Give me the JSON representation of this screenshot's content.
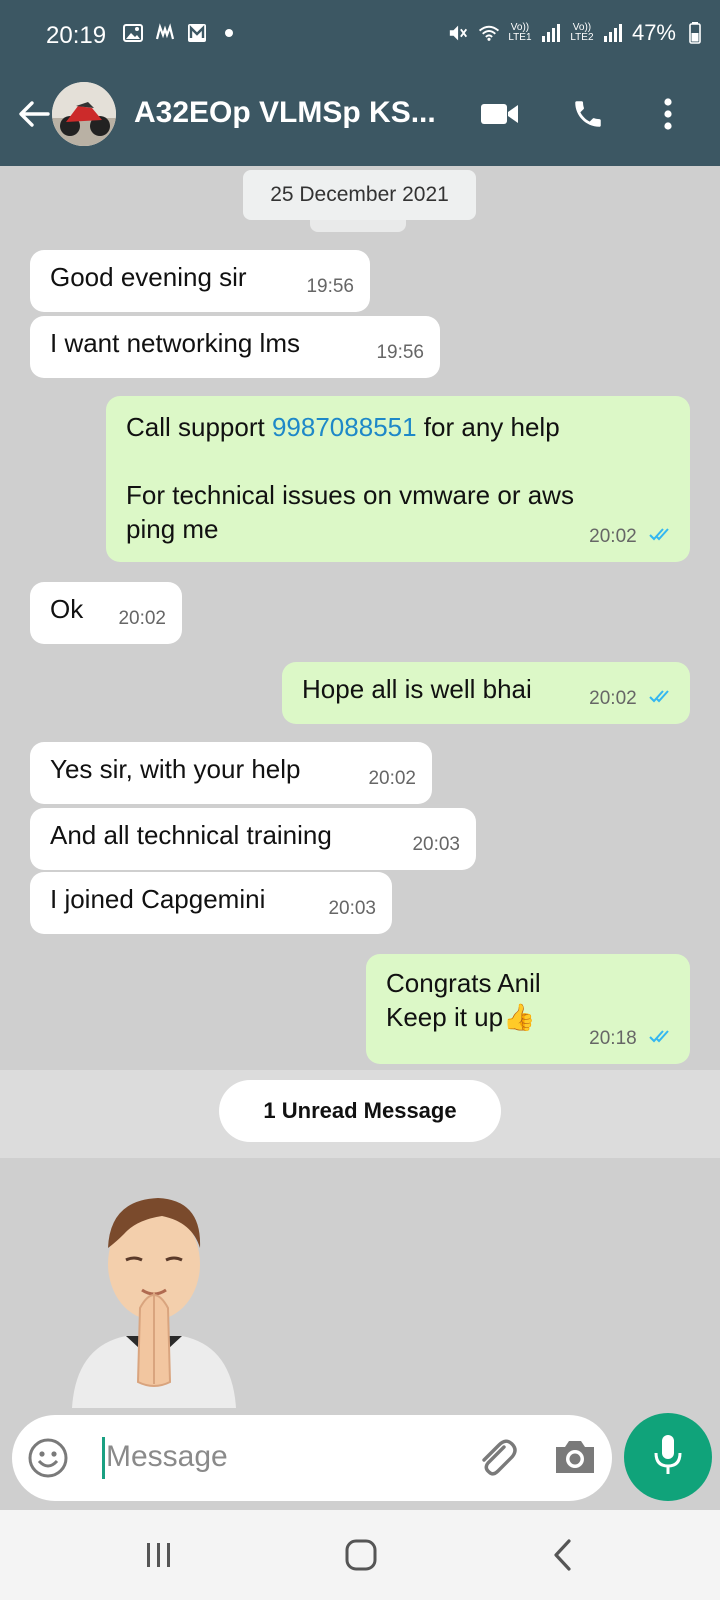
{
  "status_bar": {
    "time": "20:19",
    "battery": "47%",
    "lte1": "Vo)) LTE1",
    "lte2": "Vo)) LTE2",
    "icons": [
      "gallery-icon",
      "app-notification-icon",
      "m-notification-icon",
      "dot-icon",
      "mute-icon",
      "wifi-icon",
      "signal-icon",
      "battery-icon"
    ]
  },
  "header": {
    "title": "A32EOp VLMSp KS...",
    "actions": [
      "back-icon",
      "video-call-icon",
      "voice-call-icon",
      "more-icon"
    ]
  },
  "date_chip": "25 December 2021",
  "messages": [
    {
      "dir": "in",
      "text": "Good evening sir",
      "time": "19:56"
    },
    {
      "dir": "in",
      "text": "I want networking lms",
      "time": "19:56"
    },
    {
      "dir": "out",
      "text_before": "Call support ",
      "phone": "9987088551",
      "text_after": " for any help",
      "text_line2": "For technical issues on vmware or aws",
      "text_line3": "ping me",
      "time": "20:02"
    },
    {
      "dir": "in",
      "text": "Ok",
      "time": "20:02"
    },
    {
      "dir": "out",
      "text": "Hope all is well bhai",
      "time": "20:02"
    },
    {
      "dir": "in",
      "text": "Yes sir, with your help",
      "time": "20:02"
    },
    {
      "dir": "in",
      "text": "And all technical training",
      "time": "20:03"
    },
    {
      "dir": "in",
      "text": "I joined Capgemini",
      "time": "20:03"
    },
    {
      "dir": "out",
      "text_line1": "Congrats Anil",
      "text_line2": "Keep it up",
      "emoji": "👍",
      "time": "20:18"
    }
  ],
  "unread": "1 Unread Message",
  "composer": {
    "placeholder": "Message"
  },
  "colors": {
    "header": "#3c5763",
    "incoming": "#ffffff",
    "outgoing": "#dcf8c7",
    "accent": "#10a37a",
    "link": "#1e88c8",
    "tick": "#34b7f1"
  }
}
